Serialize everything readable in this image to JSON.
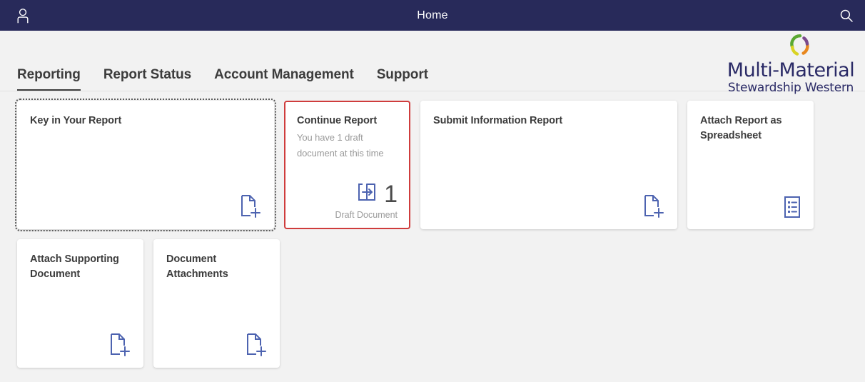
{
  "topbar": {
    "title": "Home",
    "user_icon": "user-icon",
    "search_icon": "search-icon",
    "background_color": "#282a5a",
    "text_color": "#ffffff"
  },
  "nav": {
    "active_index": 0,
    "tabs": [
      {
        "label": "Reporting"
      },
      {
        "label": "Report Status"
      },
      {
        "label": "Account Management"
      },
      {
        "label": "Support"
      }
    ]
  },
  "logo": {
    "name_line1": "Multi-Material",
    "name_line2": "Stewardship Western",
    "color": "#2a2a66",
    "ring_colors": [
      "#5aa832",
      "#d9d324",
      "#e8871e",
      "#7a4a8c"
    ]
  },
  "colors": {
    "page_background": "#f2f2f2",
    "tile_background": "#ffffff",
    "accent_blue": "#4d63b0",
    "selected_border": "#cf3c3c",
    "title_text": "#3c3c3c",
    "muted_text": "#9a9a9a"
  },
  "tiles": {
    "row1": [
      {
        "title": "Key in Your Report",
        "subtitle": "",
        "icon": "document-plus-icon",
        "width": "w2",
        "state": "focused"
      },
      {
        "title": "Continue Report",
        "subtitle": "You have 1 draft document at this time",
        "icon": "open-in-box-icon",
        "kpi_value": "1",
        "kpi_label": "Draft Document",
        "width": "w1",
        "state": "selected"
      },
      {
        "title": "Submit Information Report",
        "subtitle": "",
        "icon": "document-plus-icon",
        "width": "w2",
        "state": "default"
      },
      {
        "title": "Attach Report as Spreadsheet",
        "subtitle": "",
        "icon": "spreadsheet-list-icon",
        "width": "w1",
        "state": "default"
      }
    ],
    "row2": [
      {
        "title": "Attach Supporting Document",
        "subtitle": "",
        "icon": "document-plus-icon",
        "width": "w1",
        "state": "default"
      },
      {
        "title": "Document Attachments",
        "subtitle": "",
        "icon": "document-plus-icon",
        "width": "w1",
        "state": "default"
      }
    ]
  }
}
